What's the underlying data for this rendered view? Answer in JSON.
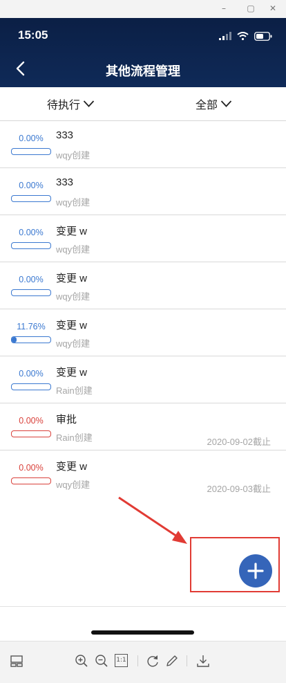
{
  "window": {
    "minimize_glyph": "–",
    "restore_glyph": "▢",
    "close_glyph": "✕"
  },
  "status_bar": {
    "time": "15:05"
  },
  "nav": {
    "title": "其他流程管理"
  },
  "filters": {
    "left": "待执行",
    "right": "全部"
  },
  "rows": [
    {
      "percent": "0.00%",
      "progress": 0,
      "title": "333",
      "creator": "wqy创建",
      "due": "",
      "status": "normal"
    },
    {
      "percent": "0.00%",
      "progress": 0,
      "title": "333",
      "creator": "wqy创建",
      "due": "",
      "status": "normal"
    },
    {
      "percent": "0.00%",
      "progress": 0,
      "title": "变更 w",
      "creator": "wqy创建",
      "due": "",
      "status": "normal"
    },
    {
      "percent": "0.00%",
      "progress": 0,
      "title": "变更 w",
      "creator": "wqy创建",
      "due": "",
      "status": "normal"
    },
    {
      "percent": "11.76%",
      "progress": 0.1176,
      "title": "变更 w",
      "creator": "wqy创建",
      "due": "",
      "status": "normal"
    },
    {
      "percent": "0.00%",
      "progress": 0,
      "title": "变更 w",
      "creator": "Rain创建",
      "due": "",
      "status": "normal"
    },
    {
      "percent": "0.00%",
      "progress": 0,
      "title": "审批",
      "creator": "Rain创建",
      "due": "2020-09-02截止",
      "status": "overdue"
    },
    {
      "percent": "0.00%",
      "progress": 0,
      "title": "变更 w",
      "creator": "wqy创建",
      "due": "2020-09-03截止",
      "status": "overdue"
    }
  ],
  "colors": {
    "accent": "#3a78d0",
    "overdue": "#d9403a",
    "nav_bg": "#0f2a58",
    "fab": "#3565b9",
    "annotation": "#e13b34"
  },
  "toolbar": {
    "icons": [
      "layout-icon",
      "zoom-in-icon",
      "zoom-out-icon",
      "actual-size-icon",
      "rotate-icon",
      "edit-icon",
      "download-icon"
    ],
    "actual_size_label": "1:1"
  }
}
